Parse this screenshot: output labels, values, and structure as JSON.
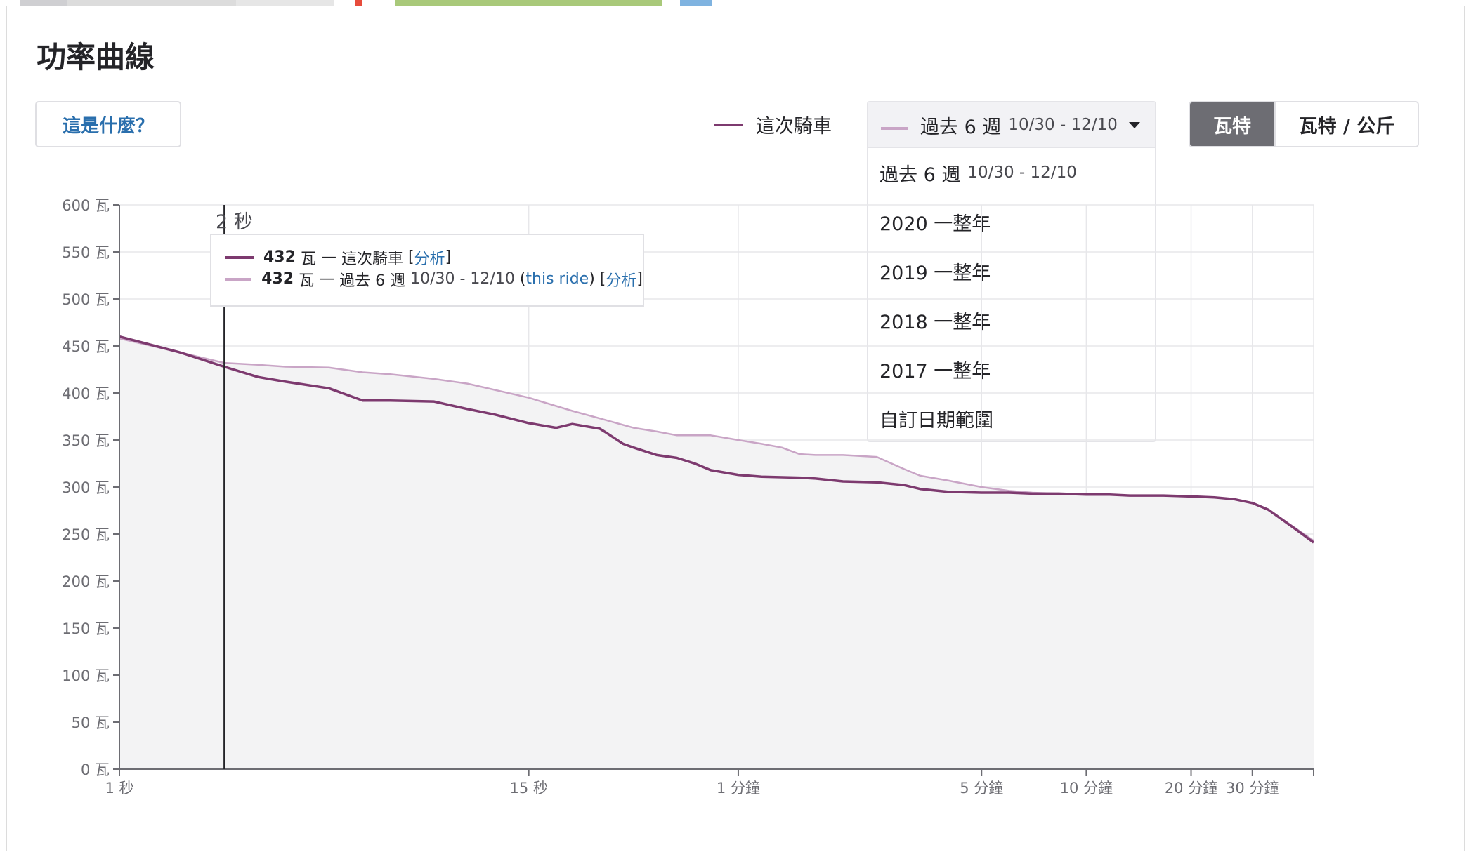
{
  "section_title": "功率曲線",
  "help_button": "這是什麼？",
  "legend": {
    "this_ride_label": "這次騎車",
    "this_ride_color": "#7d3a6f",
    "compare_color": "#c9a5c6"
  },
  "compare_select": {
    "selected_label": "過去 6 週",
    "selected_range": "10/30 - 12/10",
    "options": [
      {
        "label": "過去 6 週",
        "range": "10/30 - 12/10"
      },
      {
        "label": "2020 一整年",
        "range": ""
      },
      {
        "label": "2019 一整年",
        "range": ""
      },
      {
        "label": "2018 一整年",
        "range": ""
      },
      {
        "label": "2017 一整年",
        "range": ""
      },
      {
        "label": "自訂日期範圍",
        "range": ""
      }
    ]
  },
  "units": {
    "watts": "瓦特",
    "watts_per_kg": "瓦特 / 公斤",
    "active": "watts"
  },
  "cursor": {
    "label": "2 秒",
    "this_ride": {
      "value": "432",
      "unit": "瓦",
      "sep": "—",
      "name": "這次騎車",
      "link": "分析"
    },
    "compare": {
      "value": "432",
      "unit": "瓦",
      "sep": "—",
      "name": "過去 6 週",
      "range": "10/30 - 12/10",
      "ride_link": "this ride",
      "link": "分析"
    }
  },
  "chart_data": {
    "type": "line",
    "x_scale": "log",
    "x_unit": "seconds",
    "xlim": [
      1,
      2700
    ],
    "ylim": [
      0,
      600
    ],
    "y_ticks": [
      0,
      50,
      100,
      150,
      200,
      250,
      300,
      350,
      400,
      450,
      500,
      550,
      600
    ],
    "y_tick_labels": [
      "0 瓦",
      "50 瓦",
      "100 瓦",
      "150 瓦",
      "200 瓦",
      "250 瓦",
      "300 瓦",
      "350 瓦",
      "400 瓦",
      "450 瓦",
      "500 瓦",
      "550 瓦",
      "600 瓦"
    ],
    "x_ticks": [
      1,
      15,
      60,
      300,
      600,
      1200,
      1800
    ],
    "x_tick_labels": [
      "1 秒",
      "15 秒",
      "1 分鐘",
      "5 分鐘",
      "10 分鐘",
      "20 分鐘",
      "30 分鐘"
    ],
    "cursor_x": 2,
    "grid": true,
    "series": [
      {
        "name": "這次騎車",
        "color": "#7d3a6f",
        "x": [
          1,
          1.5,
          2,
          2.5,
          3,
          4,
          5,
          6,
          8,
          10,
          12,
          15,
          18,
          20,
          24,
          25,
          28,
          30,
          35,
          40,
          45,
          50,
          60,
          70,
          90,
          100,
          120,
          150,
          180,
          200,
          240,
          300,
          360,
          420,
          500,
          600,
          700,
          800,
          900,
          1000,
          1200,
          1400,
          1600,
          1800,
          2000,
          2400,
          2700
        ],
        "y": [
          460,
          443,
          428,
          417,
          412,
          405,
          392,
          392,
          391,
          383,
          377,
          368,
          363,
          367,
          362,
          358,
          346,
          342,
          334,
          331,
          325,
          318,
          313,
          311,
          310,
          309,
          306,
          305,
          302,
          298,
          295,
          294,
          294,
          293,
          293,
          292,
          292,
          291,
          291,
          291,
          290,
          289,
          287,
          283,
          276,
          255,
          241
        ]
      },
      {
        "name": "過去 6 週",
        "color": "#c9a5c6",
        "x": [
          1,
          1.5,
          2,
          2.5,
          3,
          4,
          5,
          6,
          8,
          10,
          15,
          20,
          24,
          30,
          35,
          40,
          50,
          60,
          70,
          80,
          90,
          100,
          120,
          150,
          180,
          200,
          240,
          300,
          360,
          420,
          500,
          600,
          700,
          800,
          900,
          1000,
          1200,
          1400,
          1600,
          1800,
          2000,
          2400,
          2700
        ],
        "y": [
          458,
          443,
          432,
          430,
          428,
          427,
          422,
          420,
          415,
          410,
          395,
          381,
          373,
          363,
          359,
          355,
          355,
          350,
          346,
          342,
          335,
          334,
          334,
          332,
          319,
          312,
          307,
          300,
          296,
          294,
          293,
          292,
          292,
          291,
          291,
          291,
          290,
          289,
          287,
          283,
          276,
          256,
          243
        ]
      }
    ]
  }
}
